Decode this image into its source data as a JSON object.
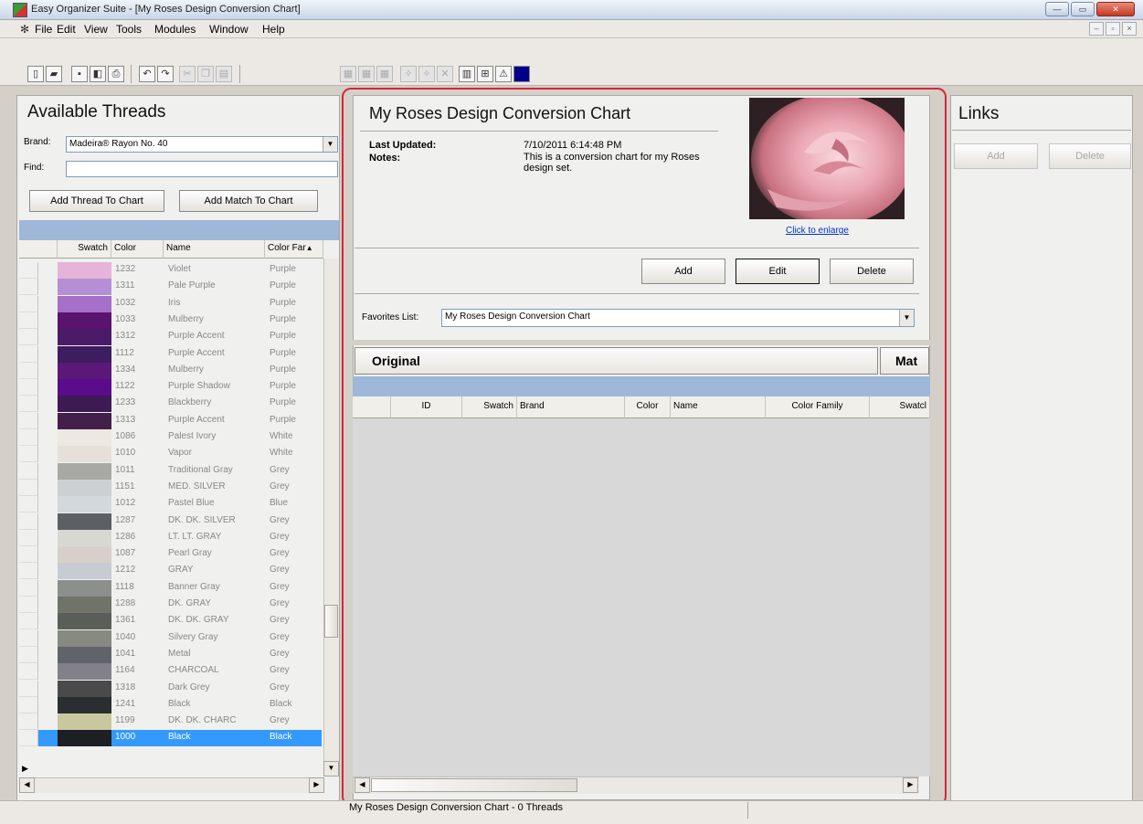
{
  "window": {
    "title": "Easy Organizer Suite - [My Roses Design Conversion Chart]",
    "minimize": "—",
    "maximize": "▭",
    "close": "✕",
    "mdi_minimize": "–",
    "mdi_restore": "▫",
    "mdi_close": "×"
  },
  "menu": {
    "items": [
      "File",
      "Edit",
      "View",
      "Tools",
      "Modules",
      "Window",
      "Help"
    ]
  },
  "toolbar": {
    "buttons": [
      "new-icon",
      "open-icon",
      "save-icon",
      "print-preview-icon",
      "print-icon",
      "undo-icon",
      "redo-icon",
      "cut-icon",
      "copy-icon",
      "paste-icon",
      "grid1-icon",
      "grid2-icon",
      "grid3-icon",
      "star-icon",
      "star2-icon",
      "delete-icon",
      "list-icon",
      "table-icon",
      "chart-icon",
      "color-icon"
    ]
  },
  "threads": {
    "title": "Available Threads",
    "brand_label": "Brand:",
    "brand_value": "Madeira® Rayon No. 40",
    "find_label": "Find:",
    "find_value": "",
    "add_thread_button": "Add Thread To Chart",
    "add_match_button": "Add Match To Chart",
    "columns": [
      "Swatch",
      "Color",
      "Name",
      "Color Far"
    ],
    "rows": [
      {
        "color": "1232",
        "name": "Violet",
        "family": "Purple",
        "swatch": "#e6b3d9"
      },
      {
        "color": "1311",
        "name": "Pale Purple",
        "family": "Purple",
        "swatch": "#b48fd4"
      },
      {
        "color": "1032",
        "name": "Iris",
        "family": "Purple",
        "swatch": "#a470c8"
      },
      {
        "color": "1033",
        "name": "Mulberry",
        "family": "Purple",
        "swatch": "#5a1470"
      },
      {
        "color": "1312",
        "name": "Purple Accent",
        "family": "Purple",
        "swatch": "#4a1c68"
      },
      {
        "color": "1112",
        "name": "Purple Accent",
        "family": "Purple",
        "swatch": "#3e1c60"
      },
      {
        "color": "1334",
        "name": "Mulberry",
        "family": "Purple",
        "swatch": "#5c1878"
      },
      {
        "color": "1122",
        "name": "Purple Shadow",
        "family": "Purple",
        "swatch": "#5a0c8c"
      },
      {
        "color": "1233",
        "name": "Blackberry",
        "family": "Purple",
        "swatch": "#3e1a52"
      },
      {
        "color": "1313",
        "name": "Purple Accent",
        "family": "Purple",
        "swatch": "#42204a"
      },
      {
        "color": "1086",
        "name": "Palest Ivory",
        "family": "White",
        "swatch": "#ede8e0"
      },
      {
        "color": "1010",
        "name": "Vapor",
        "family": "White",
        "swatch": "#e6e0d8"
      },
      {
        "color": "1011",
        "name": "Traditional Gray",
        "family": "Grey",
        "swatch": "#a8a8a4"
      },
      {
        "color": "1151",
        "name": "MED. SILVER",
        "family": "Grey",
        "swatch": "#ccd0d2"
      },
      {
        "color": "1012",
        "name": "Pastel Blue",
        "family": "Blue",
        "swatch": "#d2d8dc"
      },
      {
        "color": "1287",
        "name": "DK. DK. SILVER",
        "family": "Grey",
        "swatch": "#5c6064"
      },
      {
        "color": "1286",
        "name": "LT. LT. GRAY",
        "family": "Grey",
        "swatch": "#d8d8d2"
      },
      {
        "color": "1087",
        "name": "Pearl Gray",
        "family": "Grey",
        "swatch": "#d8d0c8"
      },
      {
        "color": "1212",
        "name": "GRAY",
        "family": "Grey",
        "swatch": "#c8ccd2"
      },
      {
        "color": "1118",
        "name": "Banner Gray",
        "family": "Grey",
        "swatch": "#8c908c"
      },
      {
        "color": "1288",
        "name": "DK. GRAY",
        "family": "Grey",
        "swatch": "#707468"
      },
      {
        "color": "1361",
        "name": "DK. DK. GRAY",
        "family": "Grey",
        "swatch": "#5a5e58"
      },
      {
        "color": "1040",
        "name": "Silvery Gray",
        "family": "Grey",
        "swatch": "#868a80"
      },
      {
        "color": "1041",
        "name": "Metal",
        "family": "Grey",
        "swatch": "#60646a"
      },
      {
        "color": "1164",
        "name": "CHARCOAL",
        "family": "Grey",
        "swatch": "#828088"
      },
      {
        "color": "1318",
        "name": "Dark Grey",
        "family": "Grey",
        "swatch": "#4a4a4c"
      },
      {
        "color": "1241",
        "name": "Black",
        "family": "Black",
        "swatch": "#2a2e30"
      },
      {
        "color": "1199",
        "name": "DK. DK. CHARC",
        "family": "Grey",
        "swatch": "#c8c8a0"
      },
      {
        "color": "1000",
        "name": "Black",
        "family": "Black",
        "swatch": "#1c2024"
      }
    ]
  },
  "chart": {
    "title": "My Roses Design Conversion Chart",
    "last_updated_label": "Last Updated:",
    "last_updated_value": "7/10/2011 6:14:48 PM",
    "notes_label": "Notes:",
    "notes_value": "This is a conversion chart for my Roses design set.",
    "enlarge_link": "Click to enlarge",
    "add_button": "Add",
    "edit_button": "Edit",
    "delete_button": "Delete",
    "favorites_label": "Favorites List:",
    "favorites_value": "My Roses Design Conversion Chart",
    "original_tab": "Original",
    "match_tab": "Mat",
    "columns": [
      "ID",
      "Swatch",
      "Brand",
      "Color",
      "Name",
      "Color Family",
      "Swatcl"
    ]
  },
  "links": {
    "title": "Links",
    "add_button": "Add",
    "delete_button": "Delete"
  },
  "status": {
    "text": "My Roses Design Conversion Chart - 0 Threads"
  },
  "colors": {
    "accent_frame": "#d8263c",
    "selection": "#3399ff",
    "header_band": "#9fb7d8",
    "link": "#0033cc"
  }
}
